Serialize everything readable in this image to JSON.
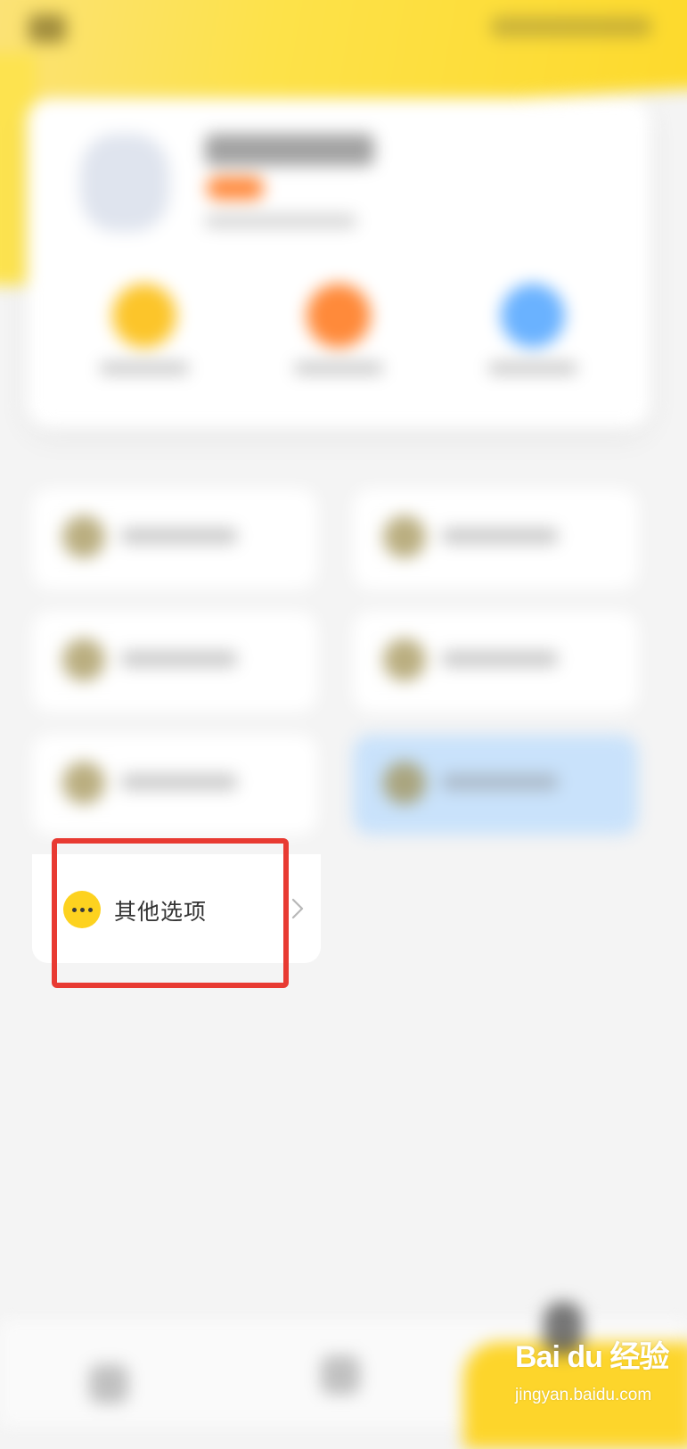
{
  "menu": {
    "other_options": {
      "label": "其他选项",
      "icon": "more-dots-icon",
      "icon_color": "#fdd21f"
    }
  },
  "annotation": {
    "highlight_color": "#e83a32"
  },
  "watermark": {
    "brand": "Bai du 经验",
    "url": "jingyan.baidu.com"
  }
}
